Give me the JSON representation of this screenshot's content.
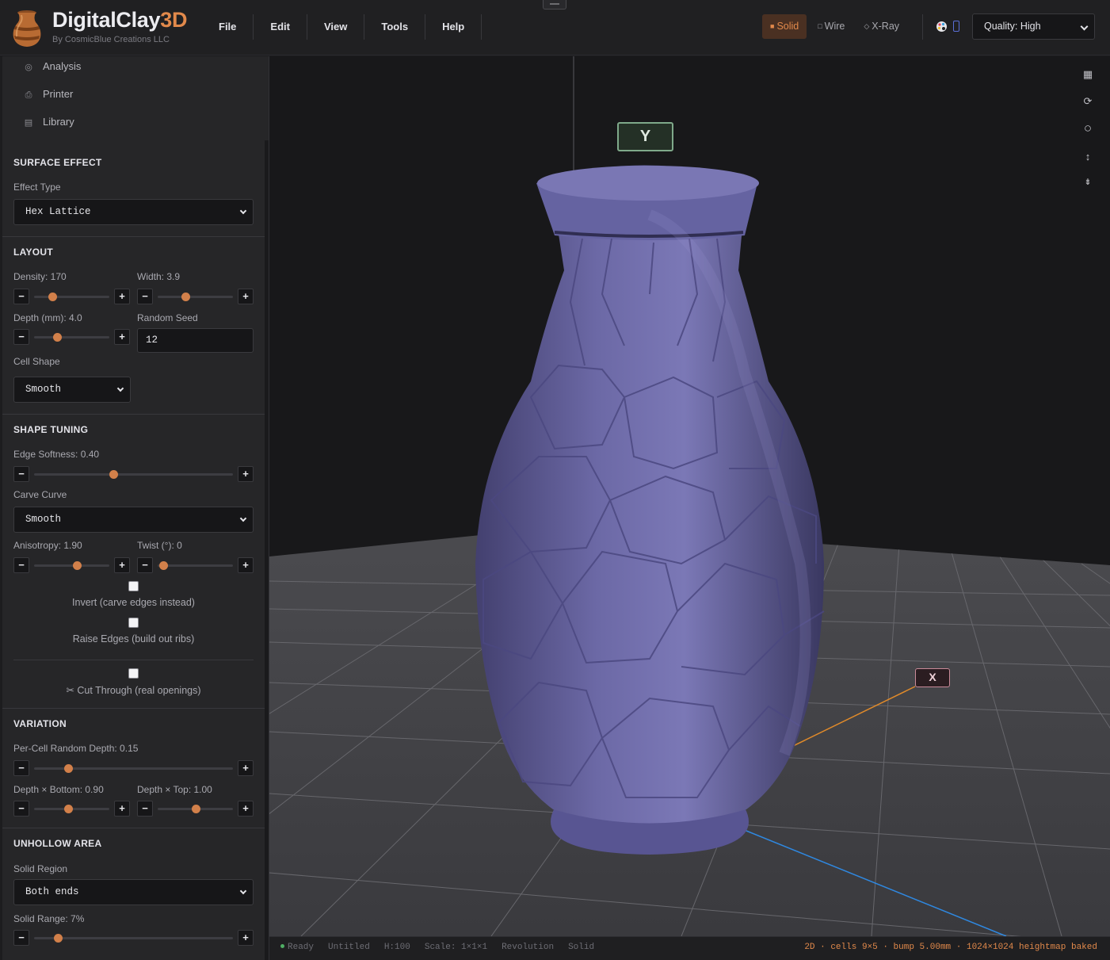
{
  "app": {
    "brand_main": "DigitalClay",
    "brand_accent": "3D",
    "subtitle": "By CosmicBlue Creations LLC"
  },
  "menu": [
    "File",
    "Edit",
    "View",
    "Tools",
    "Help"
  ],
  "view_modes": [
    {
      "label": "Solid",
      "icon": "filled-square-icon",
      "active": true
    },
    {
      "label": "Wire",
      "icon": "square-outline-icon",
      "active": false
    },
    {
      "label": "X-Ray",
      "icon": "diamond-outline-icon",
      "active": false
    }
  ],
  "quality": {
    "label": "Quality: High"
  },
  "nav": [
    {
      "label": "Analysis",
      "icon": "target-icon"
    },
    {
      "label": "Printer",
      "icon": "printer-icon"
    },
    {
      "label": "Library",
      "icon": "library-icon"
    }
  ],
  "surface_effect": {
    "title": "SURFACE EFFECT",
    "effect_type_label": "Effect Type",
    "effect_type_value": "Hex Lattice"
  },
  "layout": {
    "title": "LAYOUT",
    "density_label": "Density: 170",
    "density_pct": 0.24,
    "width_label": "Width: 3.9",
    "width_pct": 0.37,
    "depth_label": "Depth (mm): 4.0",
    "depth_pct": 0.3,
    "seed_label": "Random Seed",
    "seed_value": "12",
    "cell_shape_label": "Cell Shape",
    "cell_shape_value": "Smooth"
  },
  "shape_tuning": {
    "title": "SHAPE TUNING",
    "edge_softness_label": "Edge Softness: 0.40",
    "edge_softness_pct": 0.4,
    "carve_curve_label": "Carve Curve",
    "carve_curve_value": "Smooth",
    "anisotropy_label": "Anisotropy: 1.90",
    "anisotropy_pct": 0.57,
    "twist_label": "Twist (°): 0",
    "twist_pct": 0.07,
    "invert_label": "Invert (carve edges instead)",
    "invert_checked": false,
    "raise_label": "Raise Edges (build out ribs)",
    "raise_checked": false,
    "cut_label": "Cut Through (real openings)",
    "cut_checked": false
  },
  "variation": {
    "title": "VARIATION",
    "per_cell_label": "Per-Cell Random Depth: 0.15",
    "per_cell_pct": 0.17,
    "depth_bottom_label": "Depth × Bottom: 0.90",
    "depth_bottom_pct": 0.45,
    "depth_top_label": "Depth × Top: 1.00",
    "depth_top_pct": 0.5
  },
  "unhollow": {
    "title": "UNHOLLOW AREA",
    "solid_region_label": "Solid Region",
    "solid_region_value": "Both ends",
    "solid_range_label": "Solid Range: 7%",
    "solid_range_pct": 0.12
  },
  "viewport": {
    "axis_y": "Y",
    "axis_x": "X",
    "tools": [
      {
        "name": "grid-toggle-icon",
        "glyph": "▦"
      },
      {
        "name": "reset-rotation-icon",
        "glyph": "⟳"
      },
      {
        "name": "sphere-view-icon",
        "glyph": "○"
      },
      {
        "name": "vertical-fit-icon",
        "glyph": "↕"
      },
      {
        "name": "align-center-icon",
        "glyph": "⇟"
      }
    ]
  },
  "status": {
    "ready": "Ready",
    "file": "Untitled",
    "height": "H:100",
    "scale": "Scale: 1×1×1",
    "mode": "Revolution",
    "render": "Solid",
    "right": "2D · cells 9×5 · bump 5.00mm · 1024×1024 heightmap baked"
  },
  "colors": {
    "accent": "#e1894b",
    "vase": "#6d6aa8",
    "bg": "#18181a"
  }
}
